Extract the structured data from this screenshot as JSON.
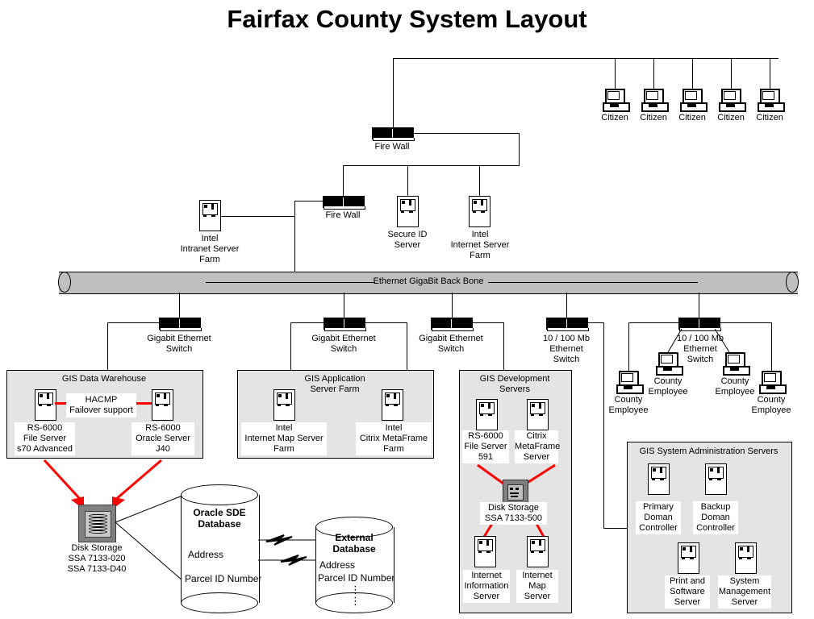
{
  "title": "Fairfax County System Layout",
  "colors": {
    "group_box_fill": "#e4e4e4",
    "backbone_fill": "#bfbfbf",
    "link_red": "#ff0000",
    "line_black": "#000000",
    "page_background": "#ffffff"
  },
  "backbone": {
    "label": "Ethernet GigaBit Back Bone"
  },
  "citizens": [
    {
      "label": "Citizen"
    },
    {
      "label": "Citizen"
    },
    {
      "label": "Citizen"
    },
    {
      "label": "Citizen"
    },
    {
      "label": "Citizen"
    }
  ],
  "firewalls": [
    {
      "label": "Fire Wall"
    },
    {
      "label": "Fire Wall"
    }
  ],
  "dmz_servers": [
    {
      "label": "Intel\nIntranet Server\nFarm",
      "line1": "Intel",
      "line2": "Intranet Server",
      "line3": "Farm"
    },
    {
      "label": "Secure ID\nServer",
      "line1": "Secure ID",
      "line2": "Server",
      "line3": ""
    },
    {
      "label": "Intel\nInternet Server\nFarm",
      "line1": "Intel",
      "line2": "Internet Server",
      "line3": "Farm"
    }
  ],
  "switches": [
    {
      "line1": "Gigabit Ethernet",
      "line2": "Switch",
      "line3": ""
    },
    {
      "line1": "Gigabit Ethernet",
      "line2": "Switch",
      "line3": ""
    },
    {
      "line1": "Gigabit Ethernet",
      "line2": "Switch",
      "line3": ""
    },
    {
      "line1": "10 / 100 Mb",
      "line2": "Ethernet",
      "line3": "Switch"
    },
    {
      "line1": "10 / 100 Mb",
      "line2": "Ethernet",
      "line3": "Switch"
    }
  ],
  "gis_data_warehouse": {
    "title": "GIS Data Warehouse",
    "hacmp_line1": "HACMP",
    "hacmp_line2": "Failover support",
    "servers": [
      {
        "line1": "RS-6000",
        "line2": "File Server",
        "line3": "s70 Advanced"
      },
      {
        "line1": "RS-6000",
        "line2": "Oracle Server",
        "line3": "J40"
      }
    ]
  },
  "gis_application_server_farm": {
    "title_line1": "GIS Application",
    "title_line2": "Server Farm",
    "servers": [
      {
        "line1": "Intel",
        "line2": "Internet Map Server",
        "line3": "Farm"
      },
      {
        "line1": "Intel",
        "line2": "Citrix MetaFrame",
        "line3": "Farm"
      }
    ]
  },
  "gis_development_servers": {
    "title_line1": "GIS Development",
    "title_line2": "Servers",
    "top_servers": [
      {
        "line1": "RS-6000",
        "line2": "File Server",
        "line3": "591"
      },
      {
        "line1": "Citrix",
        "line2": "MetaFrame",
        "line3": "Server"
      }
    ],
    "disk": {
      "line1": "Disk Storage",
      "line2": "SSA 7133-500"
    },
    "bottom_servers": [
      {
        "line1": "Internet",
        "line2": "Information",
        "line3": "Server"
      },
      {
        "line1": "Internet",
        "line2": "Map",
        "line3": "Server"
      }
    ]
  },
  "gis_system_administration_servers": {
    "title": "GIS System Administration Servers",
    "servers": [
      {
        "line1": "Primary",
        "line2": "Doman",
        "line3": "Controller"
      },
      {
        "line1": "Backup",
        "line2": "Doman",
        "line3": "Controller"
      },
      {
        "line1": "Print and",
        "line2": "Software",
        "line3": "Server"
      },
      {
        "line1": "System",
        "line2": "Management",
        "line3": "Server"
      }
    ]
  },
  "county_employees": [
    {
      "line1": "County",
      "line2": "Employee"
    },
    {
      "line1": "County",
      "line2": "Employee"
    },
    {
      "line1": "County",
      "line2": "Employee"
    },
    {
      "line1": "County",
      "line2": "Employee"
    }
  ],
  "main_disk_storage": {
    "line1": "Disk Storage",
    "line2": "SSA 7133-020",
    "line3": "SSA 7133-D40"
  },
  "oracle_sde_database": {
    "title_line1": "Oracle SDE",
    "title_line2": "Database",
    "field1": "Address",
    "field2": "Parcel ID Number"
  },
  "external_database": {
    "title_line1": "External",
    "title_line2": "Database",
    "field1": "Address",
    "field2": "Parcel ID Number",
    "ellipsis": "⋮"
  }
}
